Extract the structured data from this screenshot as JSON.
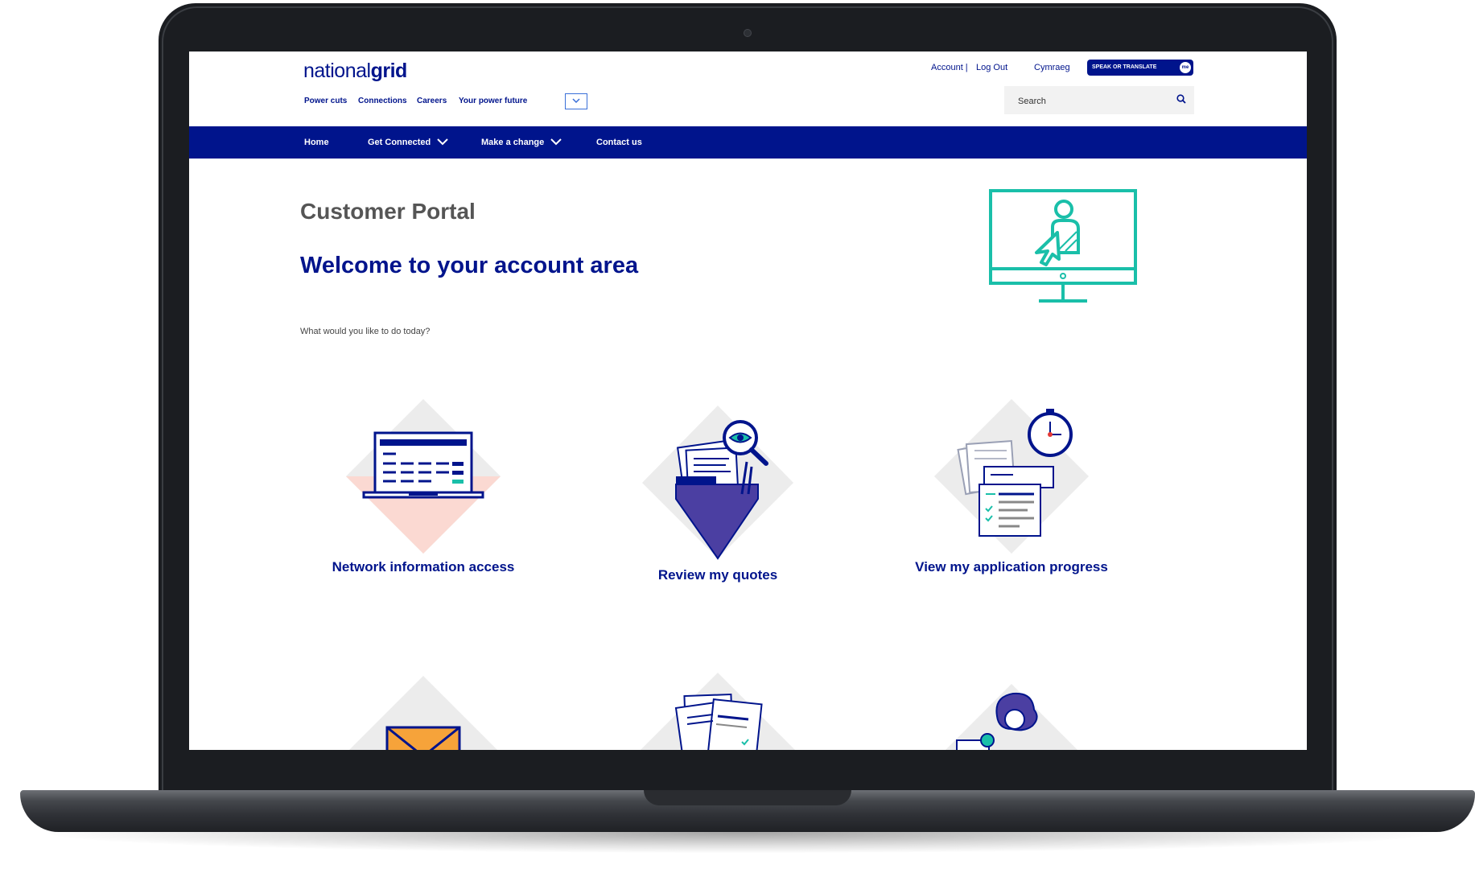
{
  "header": {
    "logo_regular": "national",
    "logo_bold": "grid",
    "account": "Account |",
    "logout": "Log Out",
    "cymraeg": "Cymraeg",
    "speak_translate": "SPEAK OR TRANSLATE",
    "speak_badge": "me",
    "search_placeholder": "Search"
  },
  "util_nav": [
    "Power cuts",
    "Connections",
    "Careers",
    "Your power future"
  ],
  "main_nav": [
    "Home",
    "Get Connected",
    "Make a change",
    "Contact us"
  ],
  "page": {
    "title": "Customer Portal",
    "welcome": "Welcome to your account area",
    "subtitle": "What would you like to do today?"
  },
  "tiles": [
    {
      "label": "Network information access",
      "icon": "laptop-icon"
    },
    {
      "label": "Review my quotes",
      "icon": "folder-magnifier-icon"
    },
    {
      "label": "View my application progress",
      "icon": "stopwatch-documents-icon"
    },
    {
      "label": "",
      "icon": "envelope-icon"
    },
    {
      "label": "",
      "icon": "documents-icon"
    },
    {
      "label": "",
      "icon": "person-avatar-icon"
    }
  ],
  "colors": {
    "brand_blue": "#00148c",
    "teal": "#1abfa9",
    "purple": "#4b3fa2",
    "peach": "#fbd9d2",
    "orange": "#f6a33a",
    "tile_grey": "#ececec"
  }
}
